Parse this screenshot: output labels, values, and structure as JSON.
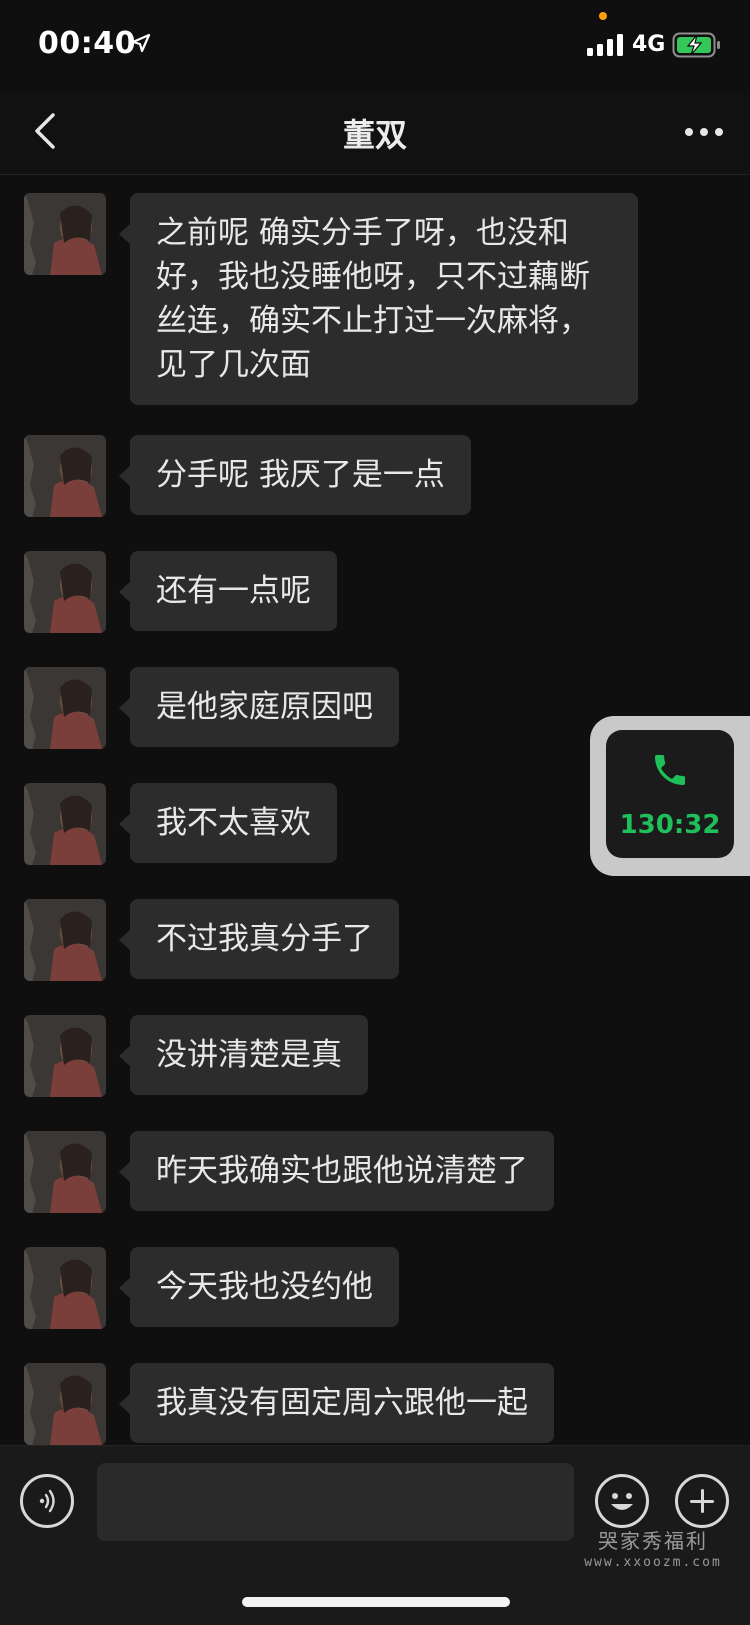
{
  "status_bar": {
    "time": "00:40",
    "network": "4G"
  },
  "nav": {
    "title": "董双"
  },
  "messages": [
    {
      "text": "之前呢 确实分手了呀，也没和好，我也没睡他呀，只不过藕断丝连，确实不止打过一次麻将，见了几次面"
    },
    {
      "text": "分手呢 我厌了是一点"
    },
    {
      "text": "还有一点呢"
    },
    {
      "text": "是他家庭原因吧"
    },
    {
      "text": "我不太喜欢"
    },
    {
      "text": "不过我真分手了"
    },
    {
      "text": "没讲清楚是真"
    },
    {
      "text": "昨天我确实也跟他说清楚了"
    },
    {
      "text": "今天我也没约他"
    },
    {
      "text": "我真没有固定周六跟他一起"
    }
  ],
  "call_widget": {
    "duration": "130:32",
    "color": "#1fbf5a"
  },
  "input": {
    "value": "",
    "placeholder": ""
  },
  "watermark": {
    "line1": "哭家秀福利",
    "line2": "www.xxoozm.com"
  },
  "icons": {
    "back": "chevron-left-icon",
    "more": "more-dots-icon",
    "voice": "voice-icon",
    "emoji": "emoji-icon",
    "plus": "plus-icon",
    "phone": "phone-icon"
  }
}
